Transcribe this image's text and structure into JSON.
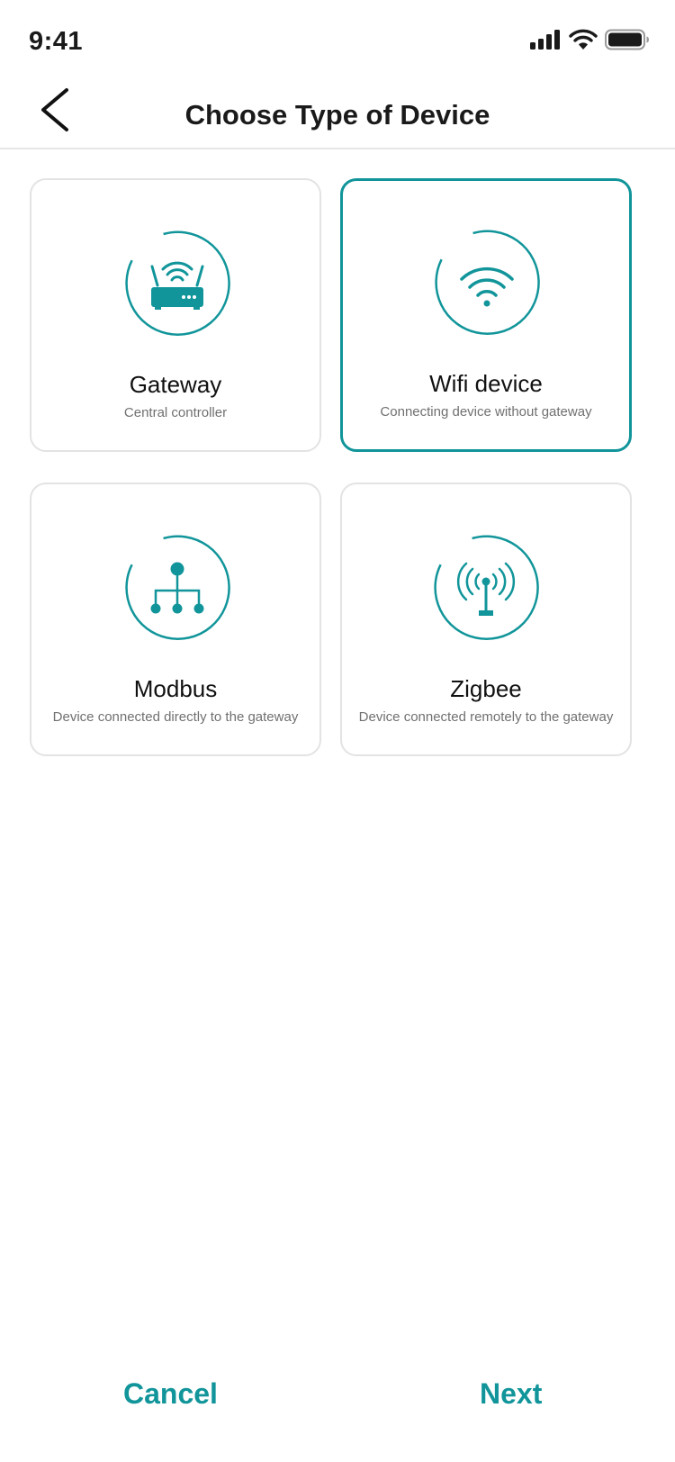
{
  "status_bar": {
    "time": "9:41",
    "icons": [
      "cellular-signal-icon",
      "wifi-icon",
      "battery-icon"
    ]
  },
  "header": {
    "title": "Choose Type of Device",
    "back_icon": "chevron-left-icon"
  },
  "colors": {
    "accent": "#11959a",
    "card_border": "#e3e3e3",
    "text_secondary": "#707070"
  },
  "device_types": [
    {
      "name": "Gateway",
      "description": "Central controller",
      "icon": "router-icon",
      "selected": false
    },
    {
      "name": "Wifi device",
      "description": "Connecting device without gateway",
      "icon": "wifi-icon",
      "selected": true
    },
    {
      "name": "Modbus",
      "description": "Device connected directly to the gateway",
      "icon": "network-tree-icon",
      "selected": false
    },
    {
      "name": "Zigbee",
      "description": "Device connected remotely to the gateway",
      "icon": "antenna-icon",
      "selected": false
    }
  ],
  "footer": {
    "cancel_label": "Cancel",
    "next_label": "Next"
  }
}
